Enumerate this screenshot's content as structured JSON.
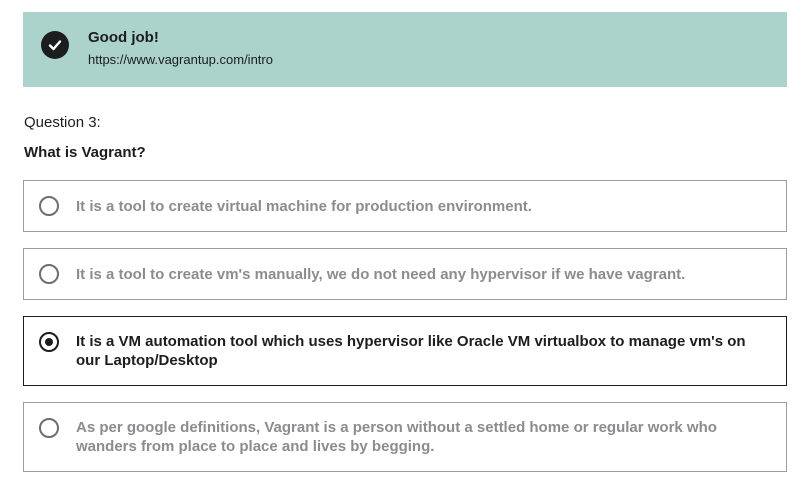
{
  "feedback": {
    "title": "Good job!",
    "link": "https://www.vagrantup.com/intro",
    "icon": "check-circle-icon",
    "background_color": "#acd2cc"
  },
  "question": {
    "number_label": "Question 3:",
    "text": "What is Vagrant?"
  },
  "options": [
    {
      "label": "It is a tool to create virtual machine for production environment.",
      "selected": false
    },
    {
      "label": "It is a tool to create vm's manually, we do not need any hypervisor if we have vagrant.",
      "selected": false
    },
    {
      "label": "It is a VM automation tool which uses hypervisor like Oracle VM virtualbox to manage vm's on our Laptop/Desktop",
      "selected": true
    },
    {
      "label": "As per google definitions, Vagrant is a person without a settled home or regular work who wanders from place to place and lives by begging.",
      "selected": false
    }
  ]
}
